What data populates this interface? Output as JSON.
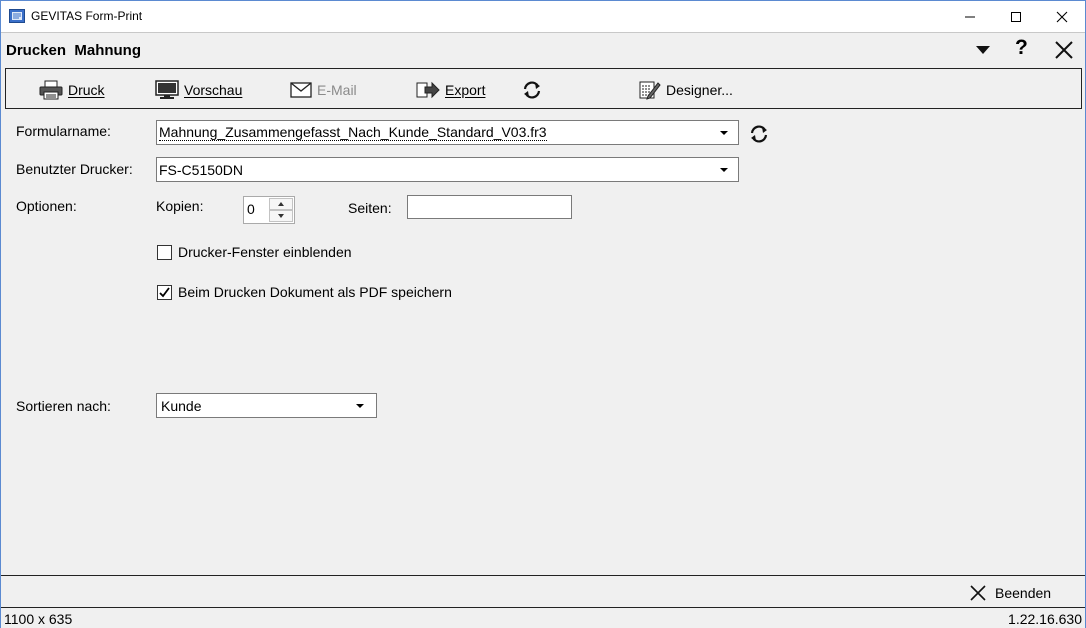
{
  "window": {
    "title": "GEVITAS Form-Print",
    "accent": "#5b8ad1"
  },
  "header": {
    "title": "Drucken  Mahnung",
    "help": "?"
  },
  "toolbar": {
    "druck": "Druck",
    "vorschau": "Vorschau",
    "email": "E-Mail",
    "export": "Export",
    "designer": "Designer..."
  },
  "form": {
    "formularname_label": "Formularname:",
    "formularname_value": "Mahnung_Zusammengefasst_Nach_Kunde_Standard_V03.fr3",
    "drucker_label": "Benutzter Drucker:",
    "drucker_value": "FS-C5150DN",
    "optionen_label": "Optionen:",
    "kopien_label": "Kopien:",
    "kopien_value": "0",
    "seiten_label": "Seiten:",
    "seiten_value": "",
    "checkbox_fenster": {
      "label": "Drucker-Fenster einblenden",
      "checked": false
    },
    "checkbox_pdf": {
      "label": "Beim Drucken Dokument als PDF speichern",
      "checked": true
    },
    "sortieren_label": "Sortieren nach:",
    "sortieren_value": "Kunde"
  },
  "footer": {
    "beenden": "Beenden"
  },
  "status": {
    "size": "1100 x 635",
    "version": "1.22.16.630"
  },
  "icons": [
    "app-icon",
    "printer-icon",
    "monitor-icon",
    "mail-icon",
    "export-icon",
    "refresh-icon",
    "designer-icon",
    "close-icon",
    "chevron-down-icon",
    "help-icon"
  ]
}
